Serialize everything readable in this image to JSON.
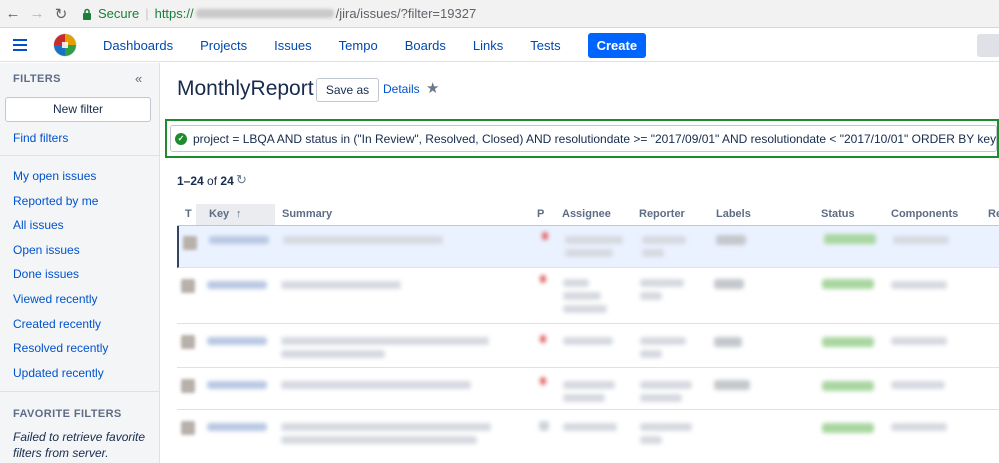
{
  "browser": {
    "back_glyph": "←",
    "forward_glyph": "→",
    "reload_glyph": "↻",
    "secure_label": "Secure",
    "url_scheme": "https://",
    "url_path": "/jira/issues/?filter=19327"
  },
  "header": {
    "nav": [
      "Dashboards",
      "Projects",
      "Issues",
      "Tempo",
      "Boards",
      "Links",
      "Tests"
    ],
    "create_label": "Create"
  },
  "sidebar": {
    "title": "FILTERS",
    "collapse_glyph": "«",
    "new_filter_label": "New filter",
    "find_filters": "Find filters",
    "links": [
      "My open issues",
      "Reported by me",
      "All issues",
      "Open issues",
      "Done issues",
      "Viewed recently",
      "Created recently",
      "Resolved recently",
      "Updated recently"
    ],
    "favorite_title": "FAVORITE FILTERS",
    "favorite_error": "Failed to retrieve favorite filters from server."
  },
  "main": {
    "title": "MonthlyReport",
    "save_as_label": "Save as",
    "details_label": "Details",
    "star_glyph": "★",
    "jql": "project = LBQA AND status in (\"In Review\", Resolved, Closed) AND resolutiondate >= \"2017/09/01\" AND resolutiondate < \"2017/10/01\" ORDER BY key ASC",
    "count_range": "1–24",
    "count_of": "of",
    "count_total": "24",
    "refresh_glyph": "↻",
    "columns": [
      "T",
      "Key",
      "Summary",
      "P",
      "Assignee",
      "Reporter",
      "Labels",
      "Status",
      "Components",
      "Re"
    ],
    "sort_glyph": "↑"
  },
  "colors": {
    "accent": "#0052cc",
    "create_button": "#0065ff",
    "highlight_border": "#1f8b2f",
    "secure_green": "#188038"
  }
}
